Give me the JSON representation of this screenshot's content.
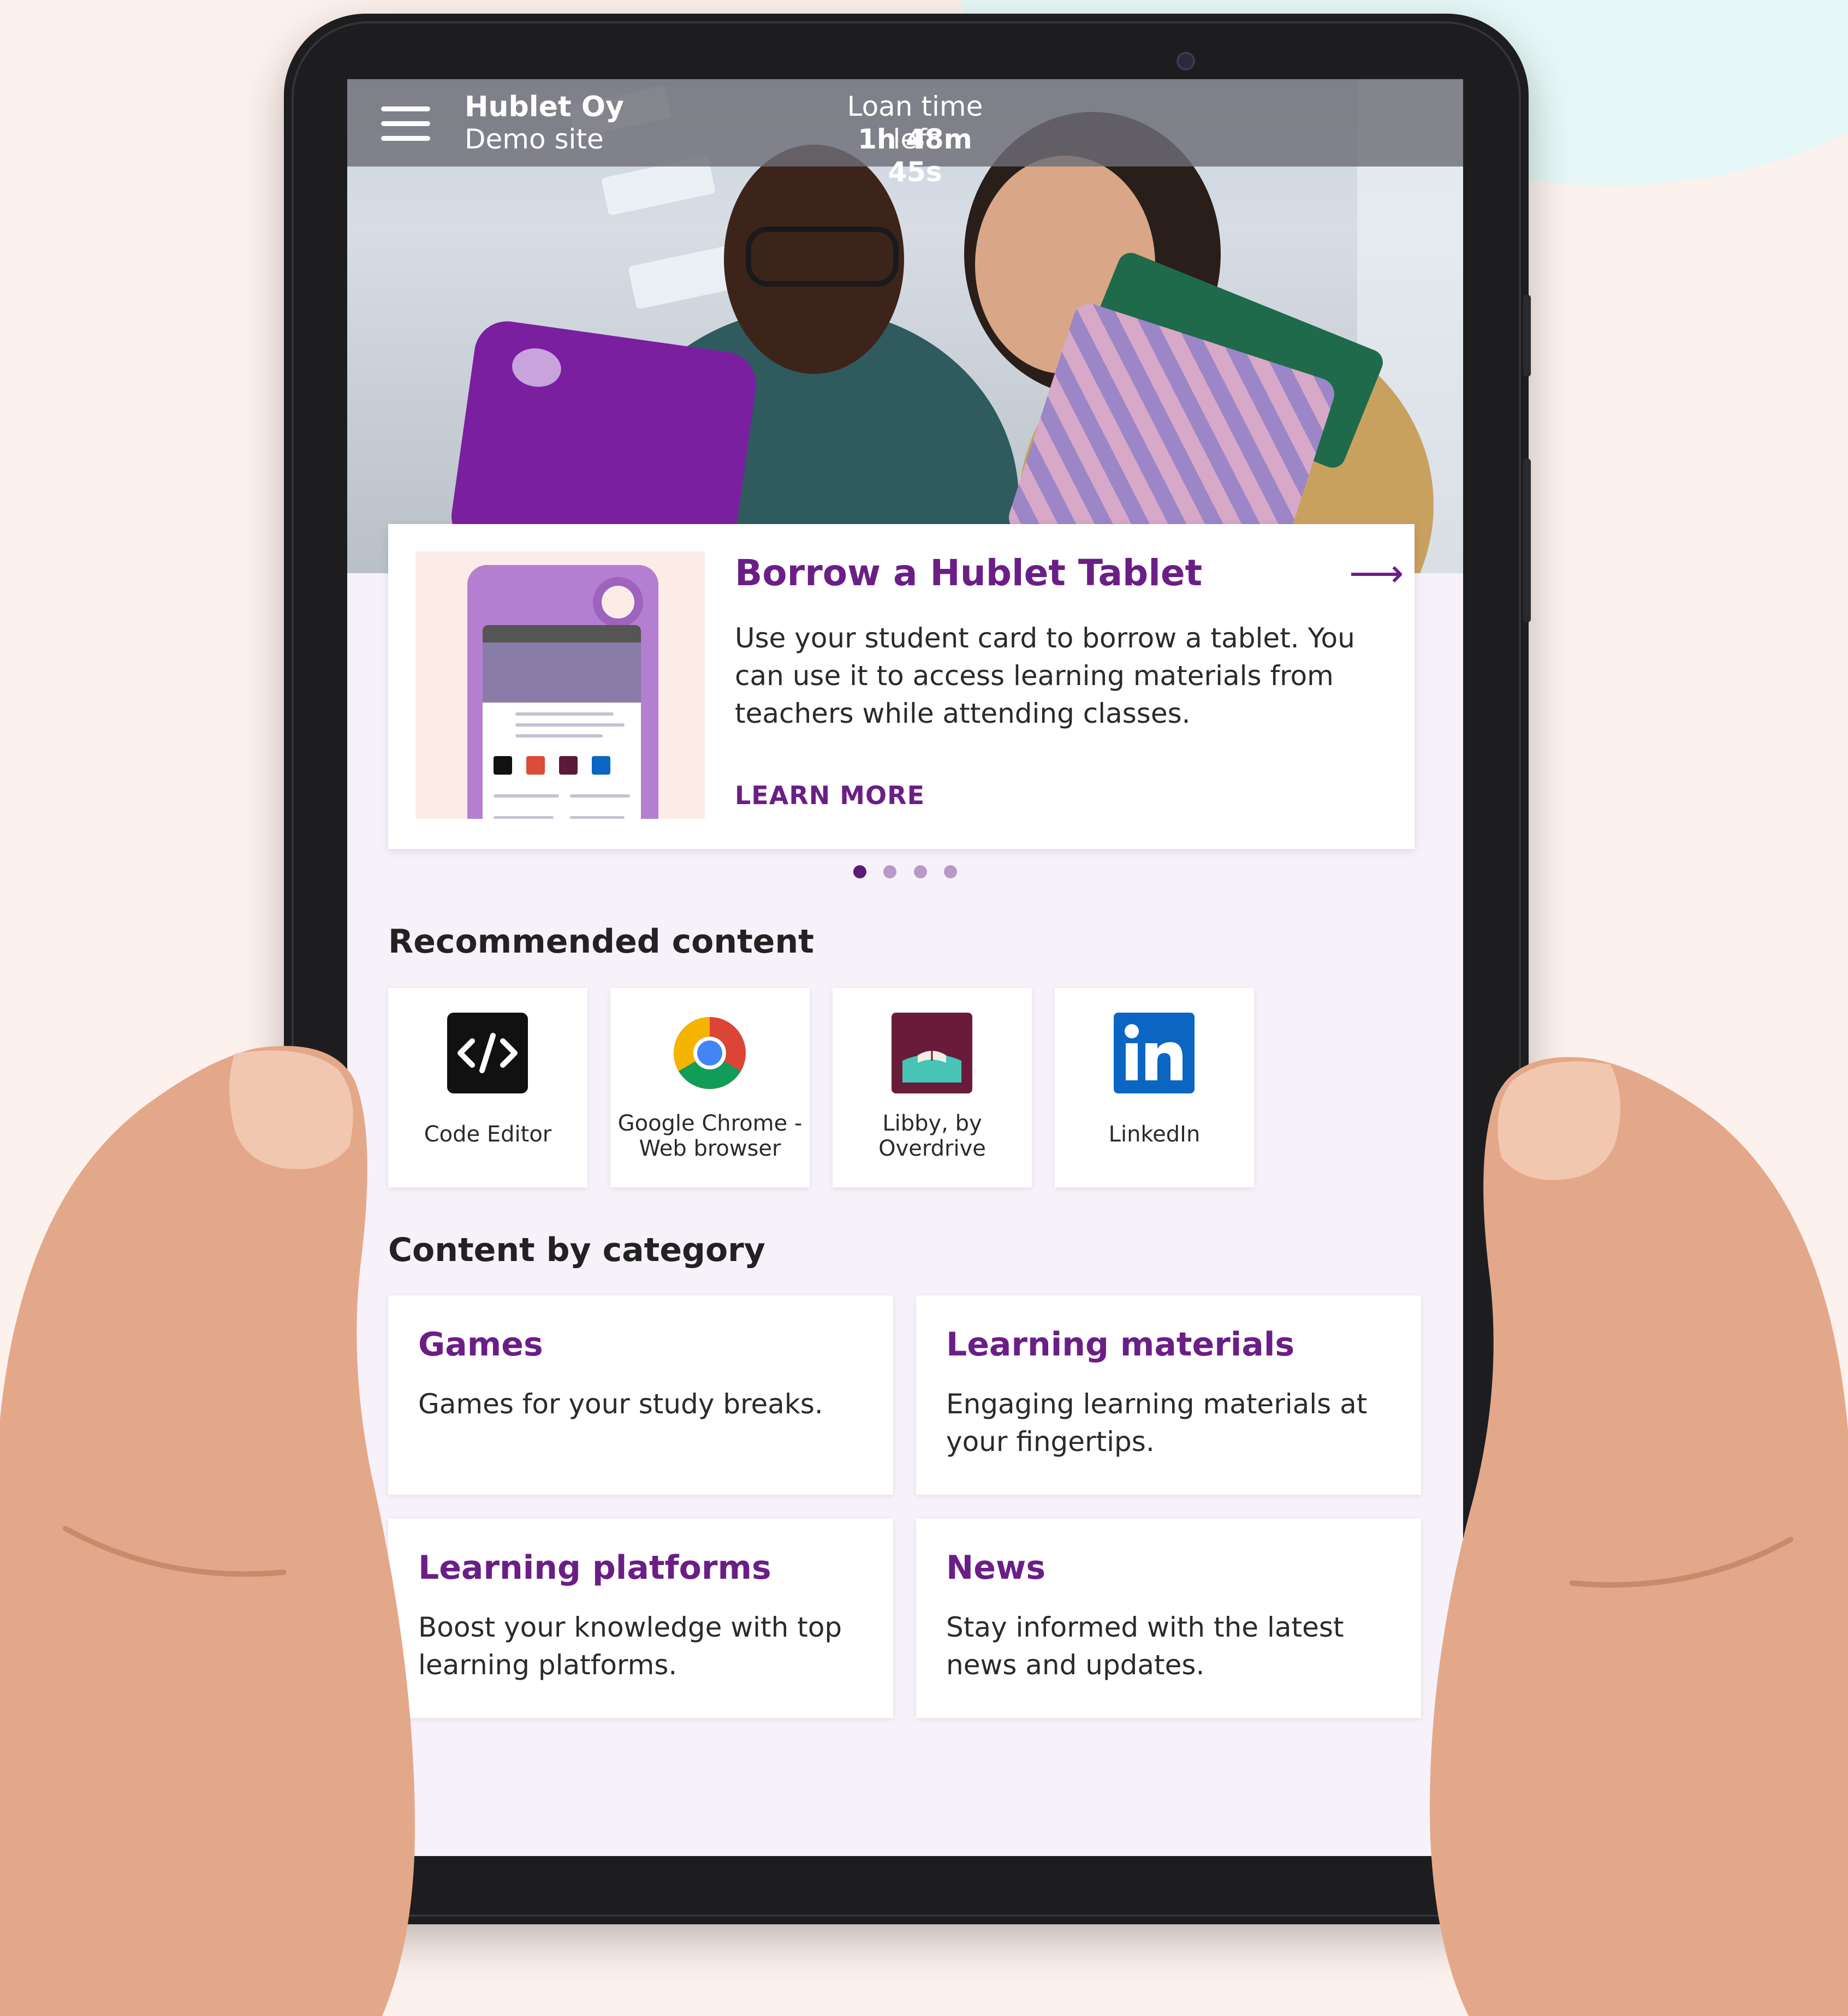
{
  "header": {
    "org_name": "Hublet Oy",
    "site_name": "Demo site",
    "loan_label": "Loan time left",
    "loan_time": "1h 48m 45s"
  },
  "promo": {
    "title": "Borrow a Hublet Tablet",
    "description": "Use your student card to borrow a tablet. You can use it to access learning materials from teachers while attending classes.",
    "link_label": "LEARN MORE",
    "slide_count": 4,
    "active_slide": 1
  },
  "recommended": {
    "title": "Recommended content",
    "apps": [
      {
        "label": "Code Editor",
        "icon": "code-editor-icon"
      },
      {
        "label": "Google Chrome - Web browser",
        "icon": "chrome-icon"
      },
      {
        "label": "Libby, by Overdrive",
        "icon": "libby-icon"
      },
      {
        "label": "LinkedIn",
        "icon": "linkedin-icon"
      }
    ]
  },
  "categories": {
    "title": "Content by category",
    "items": [
      {
        "title": "Games",
        "description": "Games for your study breaks."
      },
      {
        "title": "Learning materials",
        "description": "Engaging learning materials at your fingertips."
      },
      {
        "title": "Learning platforms",
        "description": "Boost your knowledge with top learning platforms."
      },
      {
        "title": "News",
        "description": "Stay informed with the latest news and updates."
      }
    ]
  },
  "colors": {
    "accent": "#6b1e86",
    "page_background": "#f7f1fa",
    "backdrop": "#fdf1ed",
    "cloud": "#e5f7f6"
  }
}
